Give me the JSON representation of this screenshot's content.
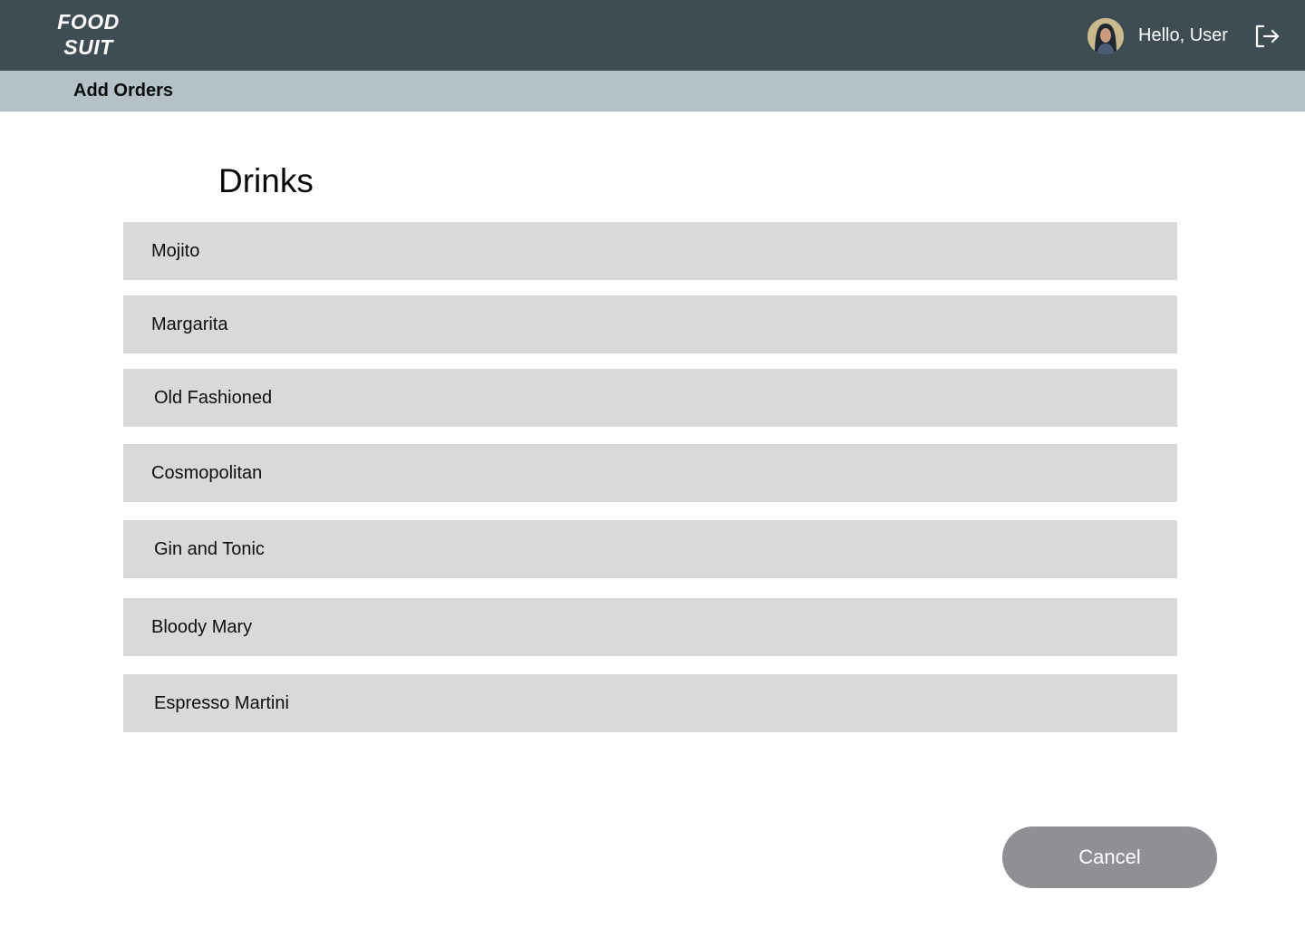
{
  "app": {
    "logo_line1": "FOOD",
    "logo_line2": "SUIT"
  },
  "header": {
    "greeting": "Hello, User",
    "avatar_icon": "user-avatar",
    "logout_icon": "logout-icon"
  },
  "subheader": {
    "title": "Add Orders"
  },
  "section": {
    "title": "Drinks"
  },
  "drinks": [
    {
      "label": "Mojito"
    },
    {
      "label": "Margarita"
    },
    {
      "label": "Old Fashioned"
    },
    {
      "label": "Cosmopolitan"
    },
    {
      "label": "Gin and Tonic"
    },
    {
      "label": "Bloody Mary"
    },
    {
      "label": "Espresso Martini"
    }
  ],
  "actions": {
    "cancel_label": "Cancel"
  },
  "colors": {
    "topbar": "#3e4c53",
    "subbar": "#b4c2c7",
    "list_item": "#d9d9d9",
    "cancel_button": "#8f8f94"
  }
}
